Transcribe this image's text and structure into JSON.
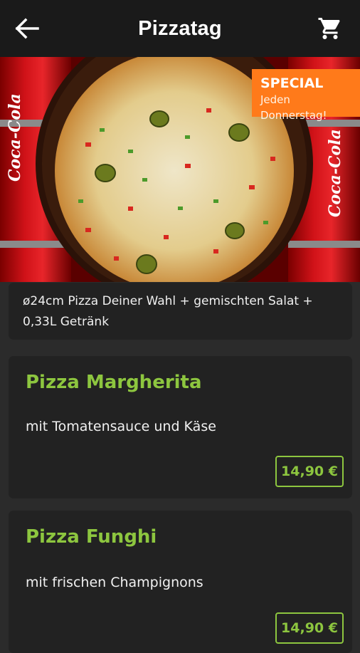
{
  "header": {
    "title": "Pizzatag",
    "back_icon": "back-arrow-icon",
    "cart_icon": "shopping-cart-icon"
  },
  "hero": {
    "badge_title": "SPECIAL",
    "badge_subtitle": "Jeden Donnerstag!",
    "badge_color": "#ff7a1a",
    "can_label": "Coca-Cola"
  },
  "description": "ø24cm Pizza Deiner Wahl + gemischten Salat + 0,33L Getränk",
  "items": [
    {
      "name": "Pizza Margherita",
      "subtitle": "mit Tomatensauce und Käse",
      "price": "14,90 €"
    },
    {
      "name": "Pizza Funghi",
      "subtitle": "mit frischen Champignons",
      "price": "14,90 €"
    }
  ],
  "colors": {
    "accent": "#8dc63f",
    "background": "#2b2b2b",
    "card": "#222222",
    "header": "#1a1a1a"
  }
}
